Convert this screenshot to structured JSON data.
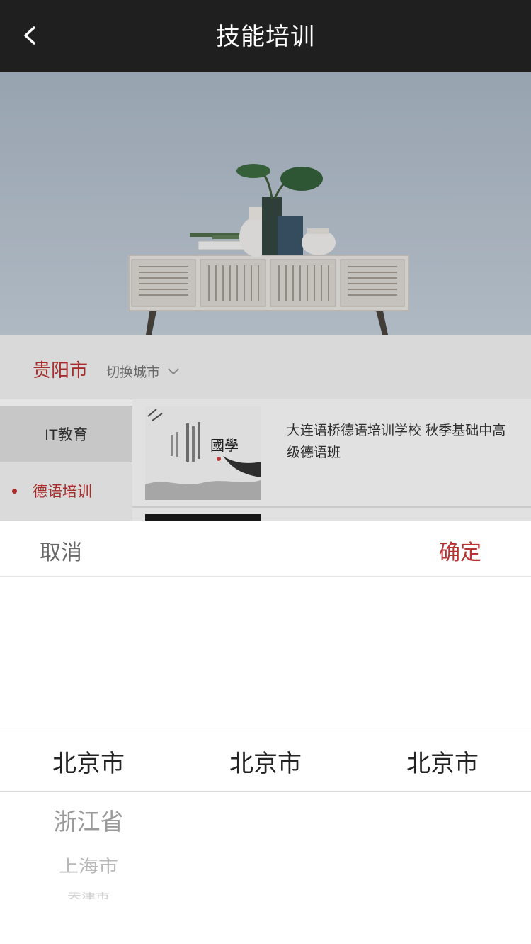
{
  "header": {
    "title": "技能培训",
    "back_icon": "chevron-left-icon"
  },
  "banner": {
    "image": "furniture-console-table-photo"
  },
  "city_bar": {
    "current_city": "贵阳市",
    "switch_label": "切换城市",
    "chevron_icon": "chevron-down-icon"
  },
  "sidebar": {
    "items": [
      {
        "label": "IT教育"
      },
      {
        "label": "德语培训"
      }
    ]
  },
  "courses": [
    {
      "title": "大连语桥德语培训学校 秋季基础中高级德语班",
      "thumb_text": "國學"
    }
  ],
  "picker": {
    "cancel_label": "取消",
    "confirm_label": "确定",
    "selected": [
      "北京市",
      "北京市",
      "北京市"
    ],
    "options": [
      "浙江省",
      "上海市",
      "天津市"
    ]
  },
  "colors": {
    "accent": "#b83232",
    "header_bg": "#1f1f1f"
  }
}
